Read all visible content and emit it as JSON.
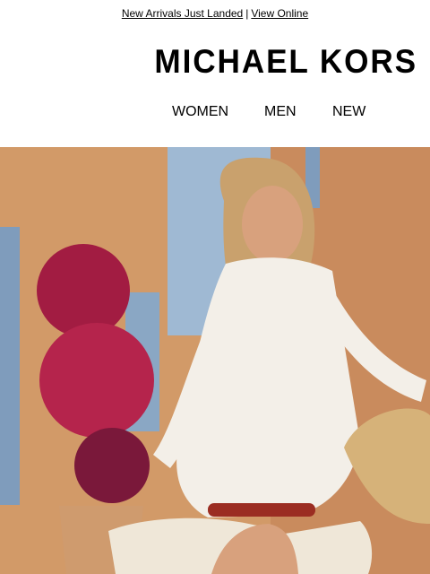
{
  "preheader": {
    "new_arrivals_label": "New Arrivals Just Landed",
    "separator": "|",
    "view_online_label": "View Online"
  },
  "brand": {
    "logo_text": "MICHAEL KORS"
  },
  "nav": {
    "items": [
      {
        "label": "WOMEN"
      },
      {
        "label": "MEN"
      },
      {
        "label": "NEW"
      }
    ]
  },
  "hero": {
    "colors": {
      "sky": "#9fb9d3",
      "wall": "#d29a68",
      "shutter": "#7f9cbc",
      "flowers": "#b5244c",
      "dress": "#f3efe8",
      "hair": "#c9a16d",
      "skin": "#d8a17d",
      "scooter": "#efe7d8"
    }
  }
}
